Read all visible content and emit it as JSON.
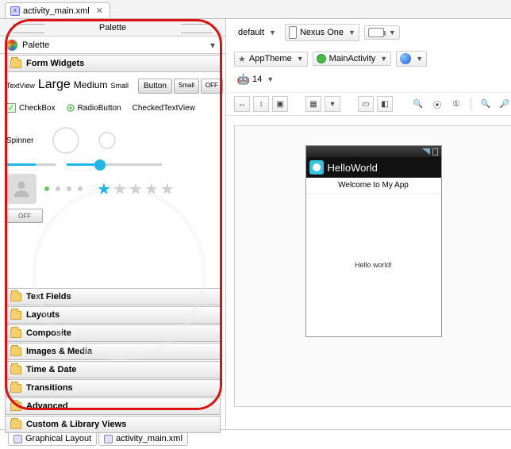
{
  "tab": {
    "filename": "activity_main.xml"
  },
  "palette": {
    "header": "Palette",
    "title": "Palette",
    "categories": {
      "form_widgets": "Form Widgets",
      "text_fields": "Text Fields",
      "layouts": "Layouts",
      "composite": "Composite",
      "images_media": "Images & Media",
      "time_date": "Time & Date",
      "transitions": "Transitions",
      "advanced": "Advanced",
      "custom_lib": "Custom & Library Views"
    },
    "form_widgets": {
      "textview_label": "TextView",
      "large": "Large",
      "medium": "Medium",
      "small_tv": "Small",
      "button": "Button",
      "small_btn": "Small",
      "off_btn": "OFF",
      "checkbox": "CheckBox",
      "radiobutton": "RadioButton",
      "checkedtextview": "CheckedTextView",
      "spinner": "Spinner",
      "off_toggle": "OFF"
    }
  },
  "bottom_tabs": {
    "graphical": "Graphical Layout",
    "xml": "activity_main.xml"
  },
  "config": {
    "default": "default",
    "device": "Nexus One",
    "theme": "AppTheme",
    "activity": "MainActivity",
    "api": "14"
  },
  "device_preview": {
    "app_title": "HelloWorld",
    "subtitle": "Welcome to My App",
    "body_text": "Hello world!"
  }
}
